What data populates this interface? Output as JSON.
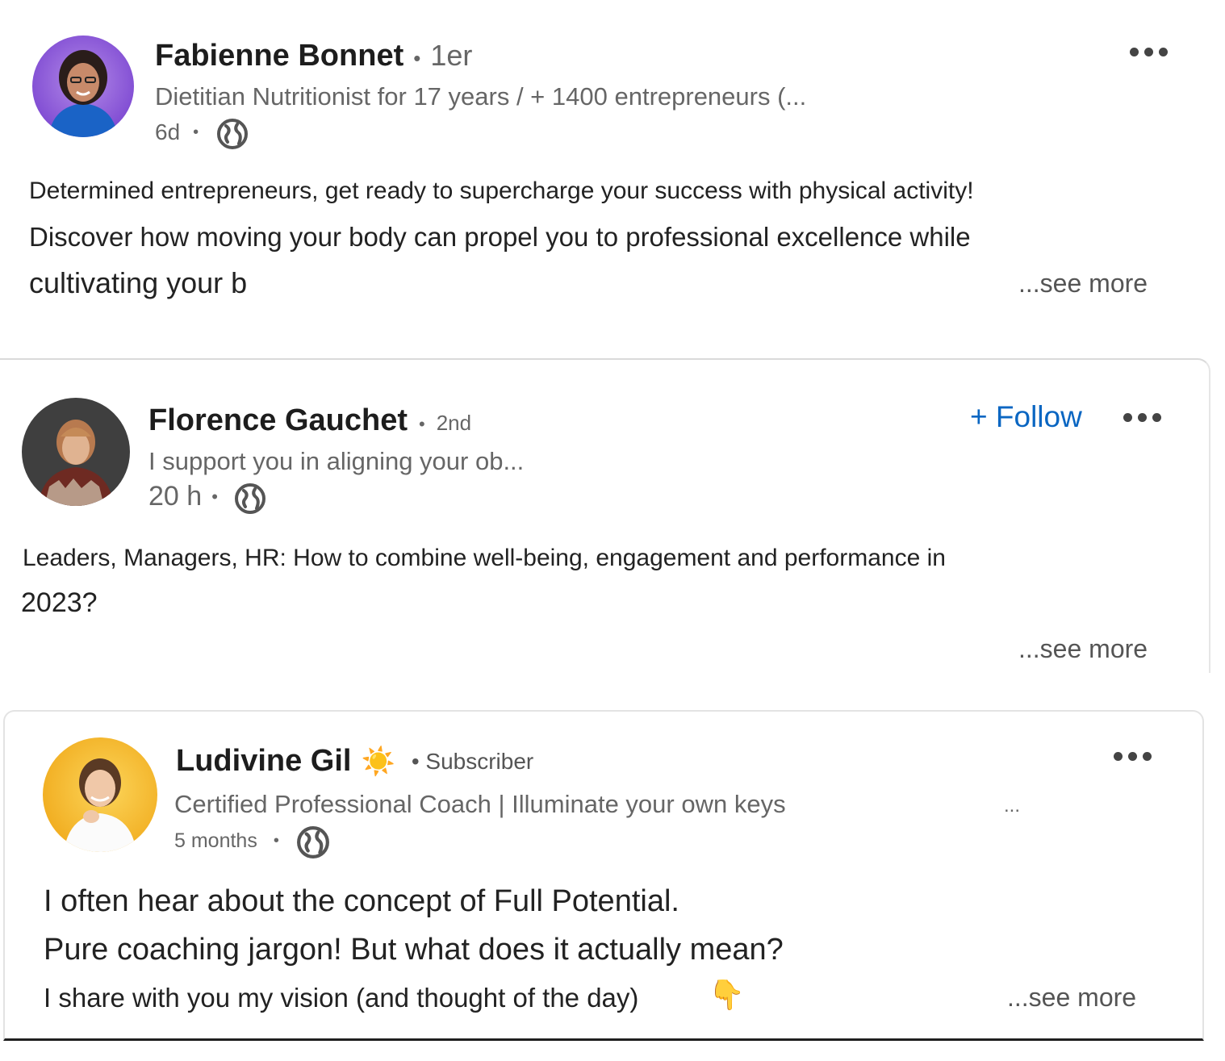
{
  "posts": [
    {
      "author": "Fabienne Bonnet",
      "separator": "•",
      "degree": "1er",
      "headline": "Dietitian Nutritionist for 17 years / + 1400 entrepreneurs (...",
      "time": "6d",
      "time_separator": "•",
      "visibility_icon": "globe-icon",
      "body_lines": [
        "Determined entrepreneurs, get ready to supercharge your success with physical activity!",
        "Discover how moving your body can propel you to professional excellence while",
        "cultivating your b"
      ],
      "see_more": "...see more",
      "menu_icon": "ellipsis-icon"
    },
    {
      "author": "Florence Gauchet",
      "separator": "•",
      "degree": "2nd",
      "headline": "I support you in aligning your ob...",
      "time": "20 h",
      "time_separator": "•",
      "visibility_icon": "globe-icon",
      "follow_label": "+ Follow",
      "body_lines": [
        "Leaders, Managers, HR: How to combine well-being, engagement and performance in",
        "2023?"
      ],
      "see_more": "...see more",
      "menu_icon": "ellipsis-icon"
    },
    {
      "author": "Ludivine Gil",
      "name_emoji": "☀️",
      "degree": "• Subscriber",
      "headline": "Certified Professional Coach | Illuminate your own keys",
      "headline_more": "...",
      "time": "5 months",
      "time_separator": "•",
      "visibility_icon": "globe-icon",
      "body_lines": [
        "I often hear about the concept of Full Potential.",
        "Pure coaching jargon! But what does it actually mean?",
        "I share with you my vision (and thought of the day)"
      ],
      "body_emoji": "👇",
      "see_more": "...see more",
      "menu_icon": "ellipsis-icon"
    }
  ],
  "colors": {
    "follow": "#0a66c2",
    "secondary_text": "#666666",
    "avatar1_ring": "#8e5bd6",
    "avatar3_bg": "#f3b820"
  }
}
